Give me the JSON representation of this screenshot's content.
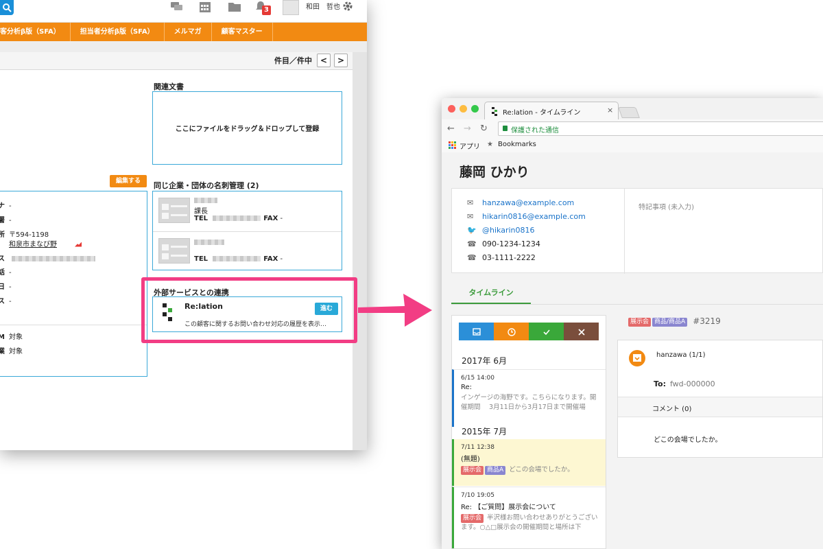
{
  "crm": {
    "topbar": {
      "notification_count": "3",
      "user_name": "和田　哲也"
    },
    "nav": [
      "客分析β版（SFA）",
      "担当者分析β版（SFA）",
      "メルマガ",
      "顧客マスター"
    ],
    "pager": {
      "label": "件目／件中",
      "prev": "<",
      "next": ">"
    },
    "related_docs": {
      "title": "関連文書",
      "drop_hint": "ここにファイルをドラッグ＆ドロップして登録"
    },
    "edit_button": "編集する",
    "info_rows": [
      {
        "key": "ナ",
        "value": "-"
      },
      {
        "key": "署",
        "value": "-"
      },
      {
        "key": "所",
        "value": "〒594-1198"
      },
      {
        "key": "",
        "value": "和泉市まなび野"
      },
      {
        "key": "ス",
        "value": ""
      },
      {
        "key": "話",
        "value": "-"
      },
      {
        "key": "日",
        "value": "-"
      },
      {
        "key": "ス",
        "value": "-"
      },
      {
        "key": "M",
        "value": "対象"
      },
      {
        "key": "業",
        "value": "対象"
      }
    ],
    "business_cards": {
      "title": "同じ企業・団体の名刺管理 (2)",
      "cards": [
        {
          "position": "課長",
          "tel_label": "TEL",
          "fax_label": "FAX",
          "fax_value": "-"
        },
        {
          "position": "",
          "tel_label": "TEL",
          "fax_label": "FAX",
          "fax_value": "-"
        }
      ]
    },
    "external": {
      "title": "外部サービスとの連携",
      "service_name": "Re:lation",
      "description": "この顧客に関するお問い合わせ対応の履歴を表示…",
      "go_button": "進む"
    }
  },
  "browser": {
    "tab_title": "Re:lation - タイムライン",
    "tab_close": "×",
    "secure_label": "保護された通信",
    "bookmarks": {
      "apps": "アプリ",
      "bookmarks": "Bookmarks"
    },
    "person_name": "藤岡 ひかり",
    "contacts": {
      "email1": "hanzawa@example.com",
      "email2": "hikarin0816@example.com",
      "twitter": "@hikarin0816",
      "mobile": "090-1234-1234",
      "phone": "03-1111-2222"
    },
    "special_notes": "特記事項 (未入力)",
    "timeline_tab": "タイムライン",
    "filter_colors": [
      "#2b8fd8",
      "#f28a12",
      "#3aa83a",
      "#7a4e3c"
    ],
    "groups": [
      {
        "month": "2017年 6月",
        "items": [
          {
            "datetime": "6/15 14:00",
            "subject": "Re:",
            "preview": "インゲージの海野です。こちらになります。開催期間　 3月11日から3月17日まで開催場"
          }
        ]
      },
      {
        "month": "2015年 7月",
        "items": [
          {
            "datetime": "7/11 12:38",
            "subject": "(無題)",
            "tags": [
              "展示会",
              "商品A"
            ],
            "preview": "どこの会場でしたか。"
          },
          {
            "datetime": "7/10 19:05",
            "subject": "Re: 【ご質問】展示会について",
            "tags": [
              "展示会"
            ],
            "preview": "半沢様お問い合わせありがとうございます。○△□展示会の開催期間と場所は下"
          }
        ]
      }
    ],
    "detail": {
      "tags": [
        "展示会",
        "商品/商品A"
      ],
      "ticket": "#3219",
      "sender": "hanzawa (1/1)",
      "to_label": "To:",
      "to_value": "fwd-000000",
      "comment_label": "コメント (0)",
      "body": "どこの会場でしたか。"
    }
  }
}
